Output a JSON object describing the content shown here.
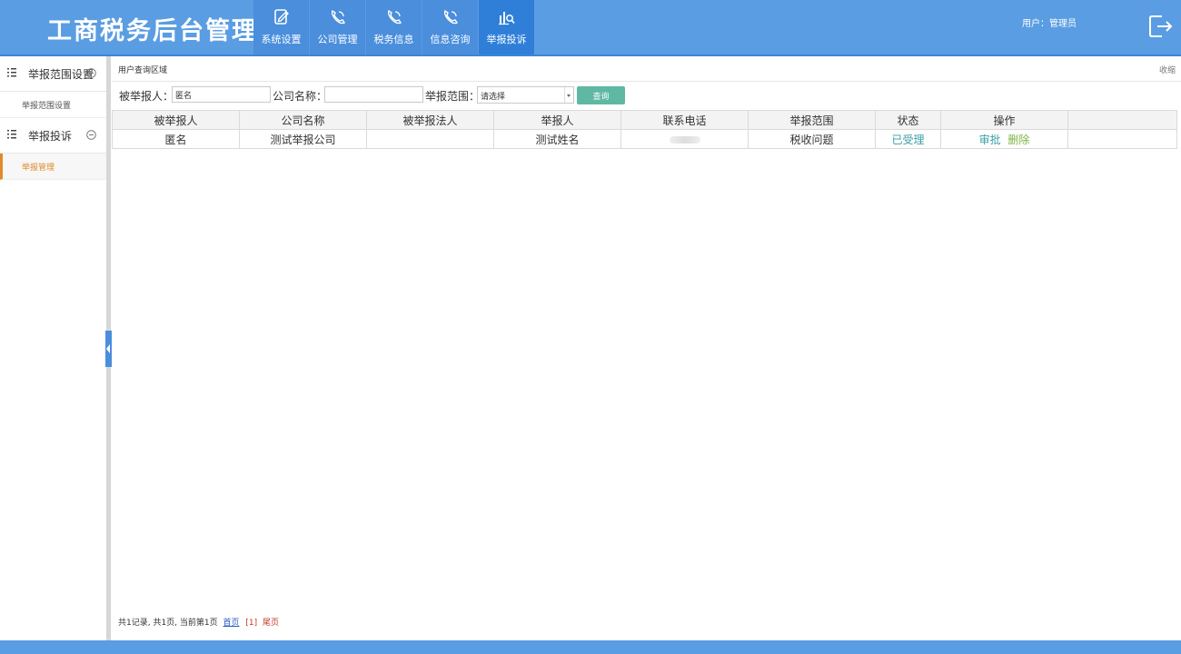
{
  "header": {
    "title": "工商税务后台管理",
    "nav": [
      {
        "label": "系统设置",
        "icon": "edit-icon"
      },
      {
        "label": "公司管理",
        "icon": "phone-icon"
      },
      {
        "label": "税务信息",
        "icon": "phone-icon"
      },
      {
        "label": "信息咨询",
        "icon": "phone-icon"
      },
      {
        "label": "举报投诉",
        "icon": "chart-search-icon",
        "active": true
      }
    ],
    "user_label": "用户：管理员"
  },
  "sidebar": {
    "groups": [
      {
        "label": "举报范围设置",
        "items": [
          "举报范围设置"
        ]
      },
      {
        "label": "举报投诉",
        "items": [
          "举报管理"
        ],
        "active_item": "举报管理"
      }
    ]
  },
  "panel": {
    "title": "用户查询区域",
    "collapse_label": "收缩"
  },
  "search": {
    "reported_label": "被举报人：",
    "reported_value": "匿名",
    "company_label": "公司名称：",
    "company_value": "",
    "scope_label": "举报范围：",
    "scope_value": "请选择",
    "query_label": "查询"
  },
  "table": {
    "columns": [
      "被举报人",
      "公司名称",
      "被举报法人",
      "举报人",
      "联系电话",
      "举报范围",
      "状态",
      "操作",
      ""
    ],
    "rows": [
      {
        "reported": "匿名",
        "company": "测试举报公司",
        "legal_person": "",
        "reporter": "测试姓名",
        "phone": "",
        "scope": "税收问题",
        "status": "已受理",
        "approve": "审批",
        "delete": "删除"
      }
    ]
  },
  "pager": {
    "summary": "共1记录, 共1页,  当前第1页",
    "first": "首页",
    "current": "[1]",
    "last": "尾页"
  },
  "colors": {
    "header_bg": "#5a9de2",
    "nav_active": "#2f7fd9",
    "query_button": "#5fb8a3",
    "active_side_item": "#e08a2b",
    "status_link": "#3a9ea5"
  }
}
